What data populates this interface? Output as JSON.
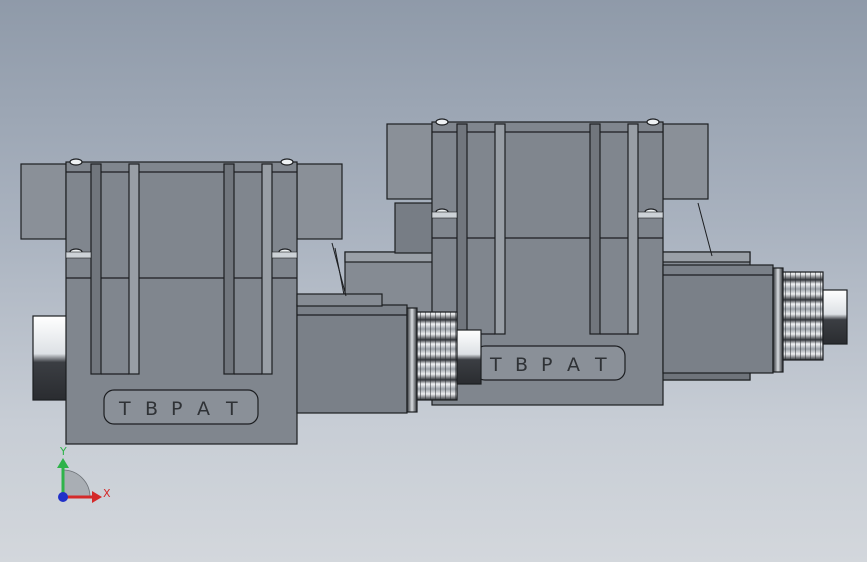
{
  "viewport": {
    "background_top": "#8f9aa9",
    "background_bottom": "#d3d7dc"
  },
  "valves": [
    {
      "engraving": [
        "T",
        "B",
        "P",
        "A",
        "T"
      ]
    },
    {
      "engraving": [
        "T",
        "B",
        "P",
        "A",
        "T"
      ]
    }
  ],
  "triad": {
    "y_label": "Y",
    "x_label": "X",
    "y_color": "#2fb34a",
    "x_color": "#d42a2a",
    "z_color": "#2030c8"
  },
  "colors": {
    "body": "#7f858d",
    "body_dark": "#5c6168",
    "edge": "#1c1e21",
    "metal_light": "#eef1f3"
  }
}
